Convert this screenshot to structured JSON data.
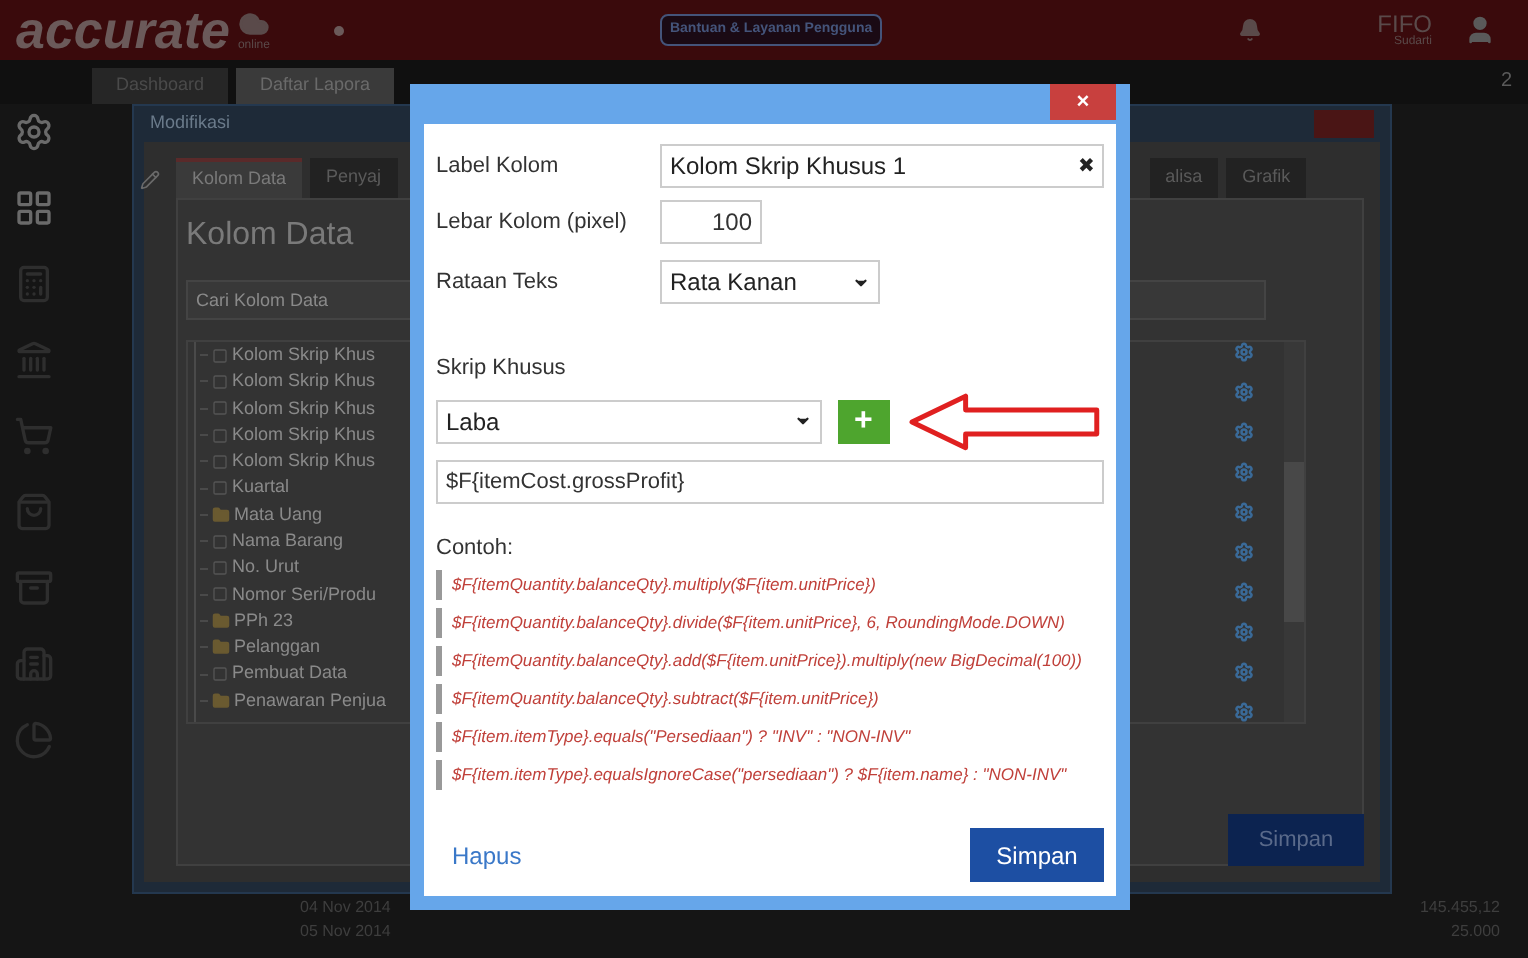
{
  "topbar": {
    "logo": "accurate",
    "logo_sub": "online",
    "help_button": "Bantuan & Layanan Pengguna",
    "user_name": "FIFO",
    "user_sub": "Sudarti"
  },
  "app_tabs": [
    {
      "label": "Dashboard",
      "selected": false
    },
    {
      "label": "Daftar Lapora",
      "selected": true
    }
  ],
  "tab_count": "2",
  "background_dialog": {
    "title": "Modifikasi",
    "tabs": [
      {
        "label": "Kolom Data",
        "selected": true
      },
      {
        "label": "Penyaj",
        "selected": false
      },
      {
        "label": "alisa",
        "selected": false
      },
      {
        "label": "Grafik",
        "selected": false
      }
    ],
    "heading": "Kolom Data",
    "search": {
      "placeholder": "Cari Kolom Data"
    },
    "tree": [
      {
        "label": "Kolom Skrip Khus",
        "kind": "field"
      },
      {
        "label": "Kolom Skrip Khus",
        "kind": "field"
      },
      {
        "label": "Kolom Skrip Khus",
        "kind": "field"
      },
      {
        "label": "Kolom Skrip Khus",
        "kind": "field"
      },
      {
        "label": "Kolom Skrip Khus",
        "kind": "field"
      },
      {
        "label": "Kuartal",
        "kind": "field"
      },
      {
        "label": "Mata Uang",
        "kind": "folder"
      },
      {
        "label": "Nama Barang",
        "kind": "field"
      },
      {
        "label": "No. Urut",
        "kind": "field"
      },
      {
        "label": "Nomor Seri/Produ",
        "kind": "field"
      },
      {
        "label": "PPh 23",
        "kind": "folder"
      },
      {
        "label": "Pelanggan",
        "kind": "folder"
      },
      {
        "label": "Pembuat Data",
        "kind": "field"
      },
      {
        "label": "Penawaran Penjua",
        "kind": "folder"
      }
    ],
    "save_button": "Simpan"
  },
  "report_rows": [
    {
      "date": "04 Nov 2014",
      "amount": "145.455,12"
    },
    {
      "date": "05 Nov 2014",
      "amount": "25.000"
    }
  ],
  "dialog": {
    "close": "×",
    "label_kolom": {
      "label": "Label Kolom",
      "value": "Kolom Skrip Khusus 1",
      "clear": "✖"
    },
    "lebar_kolom": {
      "label": "Lebar Kolom (pixel)",
      "value": "100"
    },
    "rataan_teks": {
      "label": "Rataan Teks",
      "value": "Rata Kanan"
    },
    "skrip_khusus": {
      "label": "Skrip Khusus",
      "value": "Laba",
      "add": "+",
      "script": "$F{itemCost.grossProfit}"
    },
    "examples_title": "Contoh:",
    "examples": [
      "$F{itemQuantity.balanceQty}.multiply($F{item.unitPrice})",
      "$F{itemQuantity.balanceQty}.divide($F{item.unitPrice}, 6, RoundingMode.DOWN)",
      "$F{itemQuantity.balanceQty}.add($F{item.unitPrice}).multiply(new BigDecimal(100))",
      "$F{itemQuantity.balanceQty}.subtract($F{item.unitPrice})",
      "$F{item.itemType}.equals(\"Persediaan\") ? \"INV\" : \"NON-INV\"",
      "$F{item.itemType}.equalsIgnoreCase(\"persediaan\") ? $F{item.name} : \"NON-INV\""
    ],
    "delete_button": "Hapus",
    "save_button": "Simpan"
  }
}
